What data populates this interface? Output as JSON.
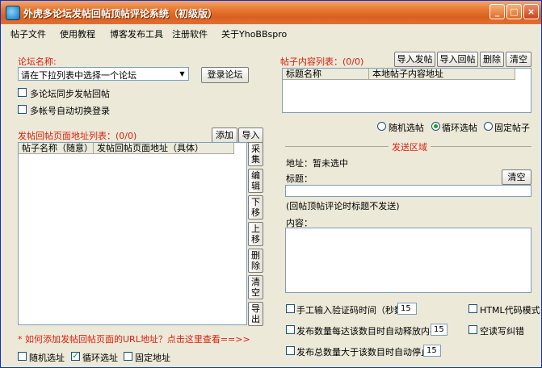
{
  "window": {
    "title": "外虎多论坛发帖回帖顶帖评论系统（初级版）"
  },
  "menu": [
    "帖子文件",
    "使用教程",
    "博客发布工具",
    "注册软件",
    "关于YhoBBspro"
  ],
  "forum": {
    "label": "论坛名称:",
    "select_value": "请在下拉列表中选择一个论坛",
    "login_button": "登录论坛",
    "option_sync_reply": "多论坛同步发帖回帖",
    "option_auto_switch": "多帐号自动切换登录"
  },
  "url_list": {
    "label": "发帖回帖页面地址列表：",
    "count": "(0/0)",
    "add_button": "添加",
    "import_button": "导入",
    "columns": [
      "帖子名称（随意）",
      "发帖回帖页面地址（具体）"
    ],
    "side_buttons": [
      "采集",
      "编辑",
      "下移",
      "上移",
      "删除",
      "清空",
      "导出"
    ],
    "help_link": "* 如何添加发帖回帖页面的URL地址？点击这里查看==>>",
    "mode_random": "随机选址",
    "mode_loop": "循环选址",
    "mode_fixed": "固定地址"
  },
  "content_list": {
    "label": "帖子内容列表：",
    "count": "(0/0)",
    "import_post": "导入发帖",
    "import_reply": "导入回帖",
    "delete": "删除",
    "clear": "清空",
    "columns": [
      "标题名称",
      "本地帖子内容地址"
    ],
    "mode_random": "随机选帖",
    "mode_loop": "循环选帖",
    "mode_fixed": "固定帖子"
  },
  "send_area": {
    "group_title": "发送区域",
    "address_label": "地址：",
    "address_value": "暂未选中",
    "title_label": "标题：",
    "clear_button": "清空",
    "hint": "(回帖顶帖评论时标题不发送)",
    "content_label": "内容："
  },
  "options": {
    "captcha_manual": "手工输入验证码时间（秒数）",
    "captcha_seconds": "15",
    "html_mode": "HTML代码模式",
    "release_memory": "发布数量每达该数目时自动释放内存",
    "release_count": "15",
    "space_fix": "空读写纠错",
    "stop_total": "发布总数量大于该数目时自动停止",
    "stop_count": "15"
  }
}
